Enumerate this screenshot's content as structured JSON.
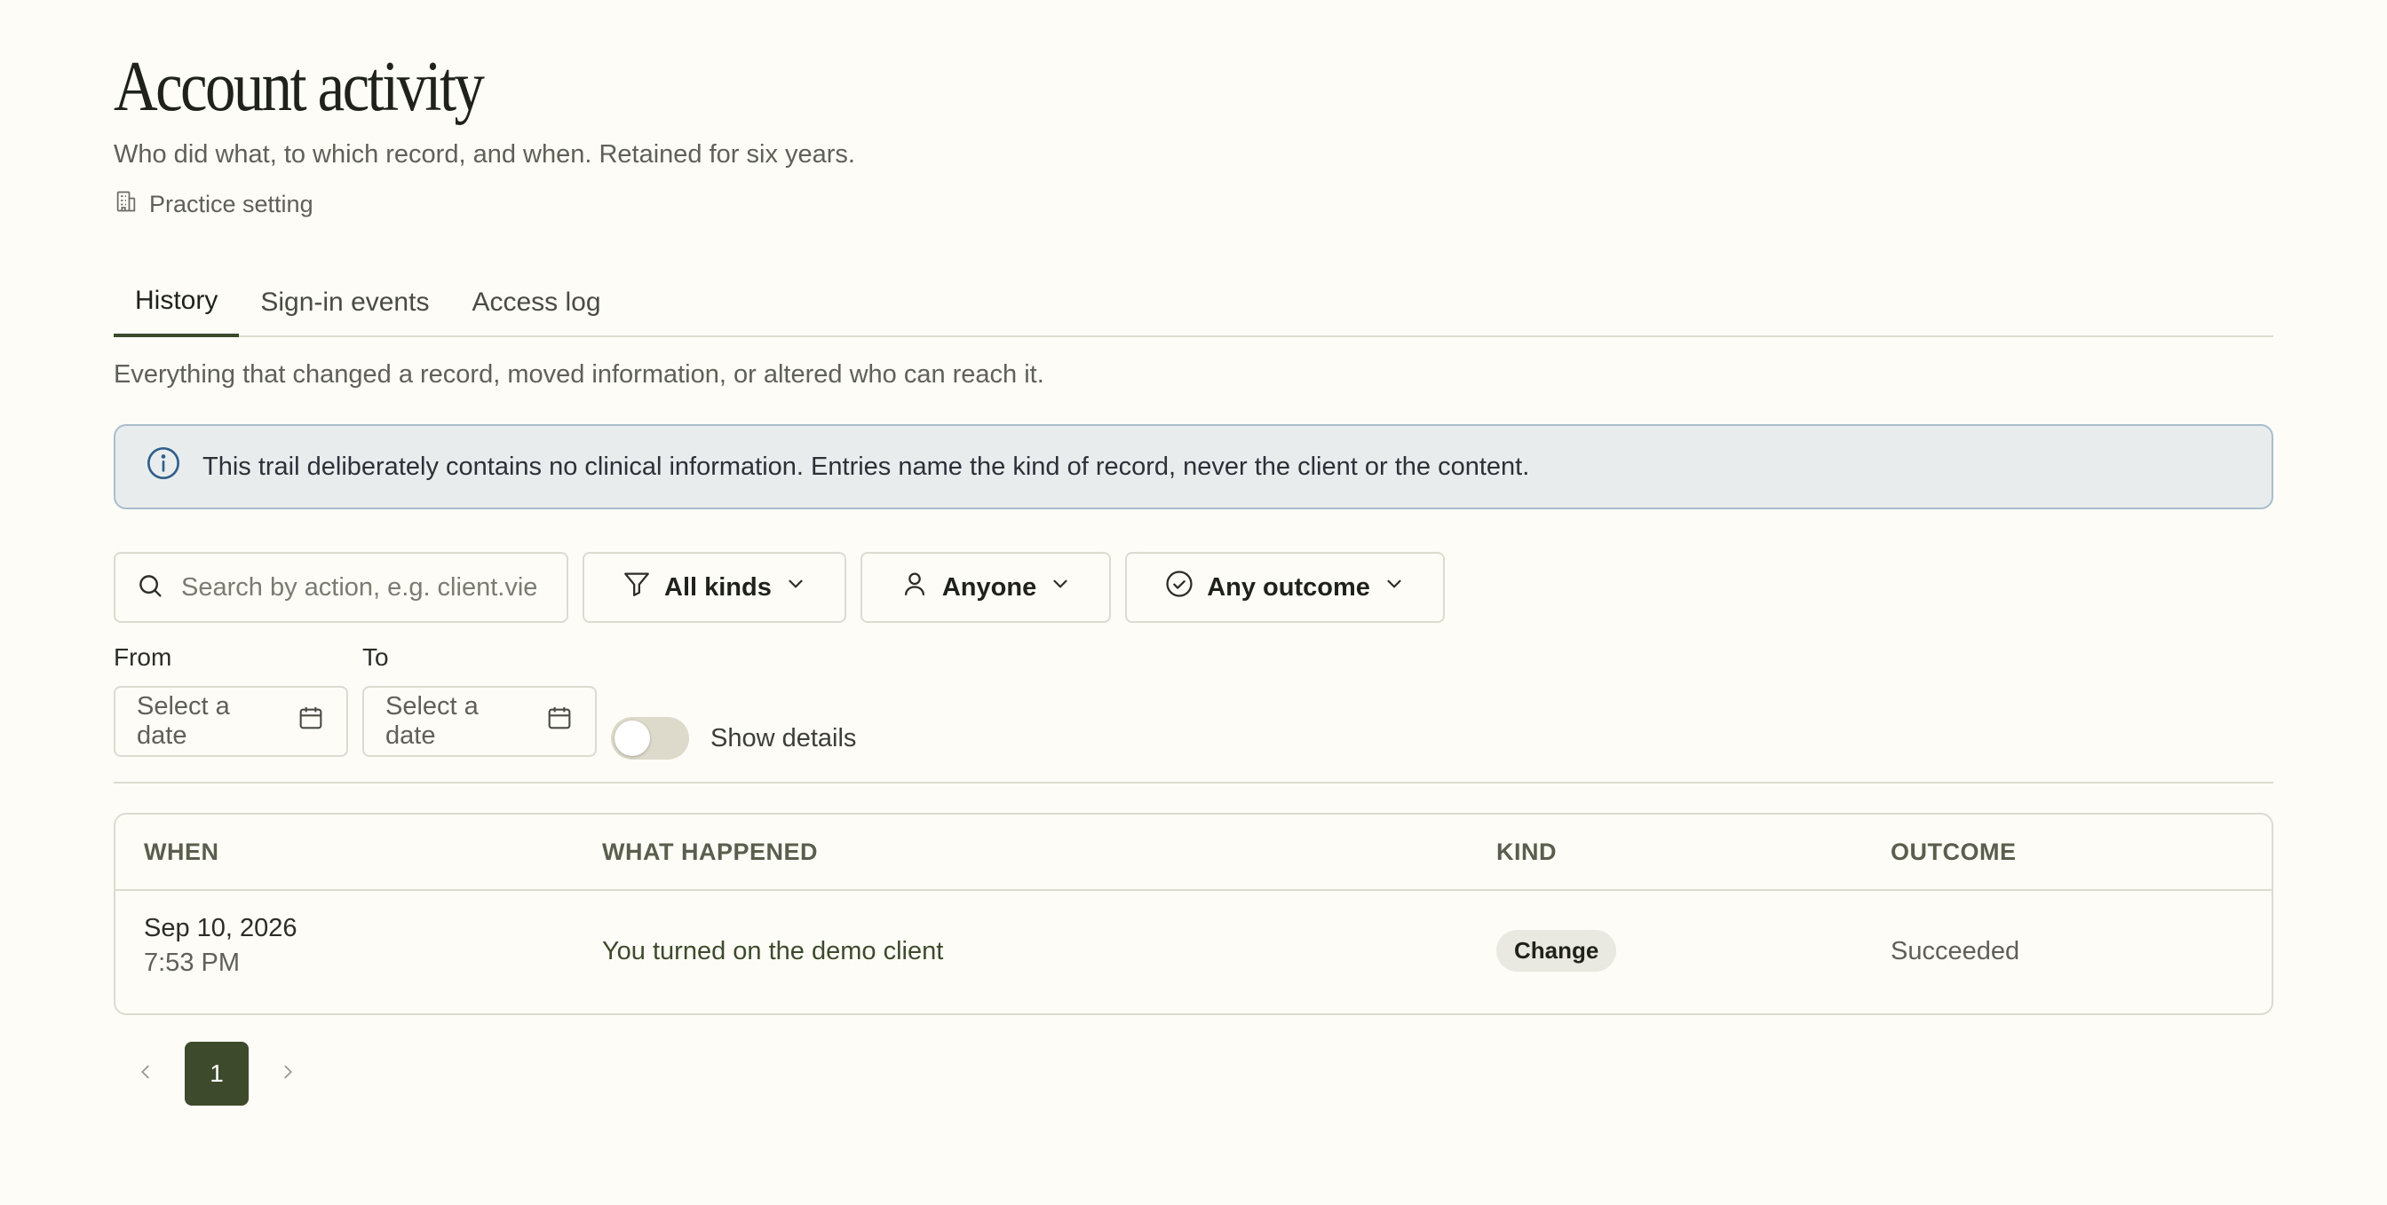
{
  "header": {
    "title": "Account activity",
    "subtitle": "Who did what, to which record, and when. Retained for six years.",
    "setting_label": "Practice setting"
  },
  "tabs": [
    {
      "label": "History",
      "active": true
    },
    {
      "label": "Sign-in events",
      "active": false
    },
    {
      "label": "Access log",
      "active": false
    }
  ],
  "tab_description": "Everything that changed a record, moved information, or altered who can reach it.",
  "banner": {
    "text": "This trail deliberately contains no clinical information. Entries name the kind of record, never the client or the content."
  },
  "filters": {
    "search_placeholder": "Search by action, e.g. client.vie",
    "kind_label": "All kinds",
    "person_label": "Anyone",
    "outcome_label": "Any outcome",
    "from_label": "From",
    "to_label": "To",
    "from_placeholder": "Select a date",
    "to_placeholder": "Select a date",
    "show_details_label": "Show details",
    "show_details_on": false
  },
  "table": {
    "columns": [
      "WHEN",
      "WHAT HAPPENED",
      "KIND",
      "OUTCOME"
    ],
    "rows": [
      {
        "date": "Sep 10, 2026",
        "time": "7:53 PM",
        "what": "You turned on the demo client",
        "kind": "Change",
        "outcome": "Succeeded"
      }
    ]
  },
  "pagination": {
    "current_page": "1"
  },
  "colors": {
    "accent": "#3d4a2c",
    "background": "#fdfcf7",
    "banner_bg": "#e8ecec",
    "banner_border": "#a9bdcc",
    "info_icon": "#2f5f8a"
  },
  "icons": {
    "setting": "building-icon",
    "banner": "info-icon",
    "search": "search-icon",
    "kind": "filter-icon",
    "person": "user-icon",
    "outcome": "check-circle-icon",
    "dropdown": "chevron-down-icon",
    "date": "calendar-icon",
    "prev": "chevron-left-icon",
    "next": "chevron-right-icon"
  }
}
